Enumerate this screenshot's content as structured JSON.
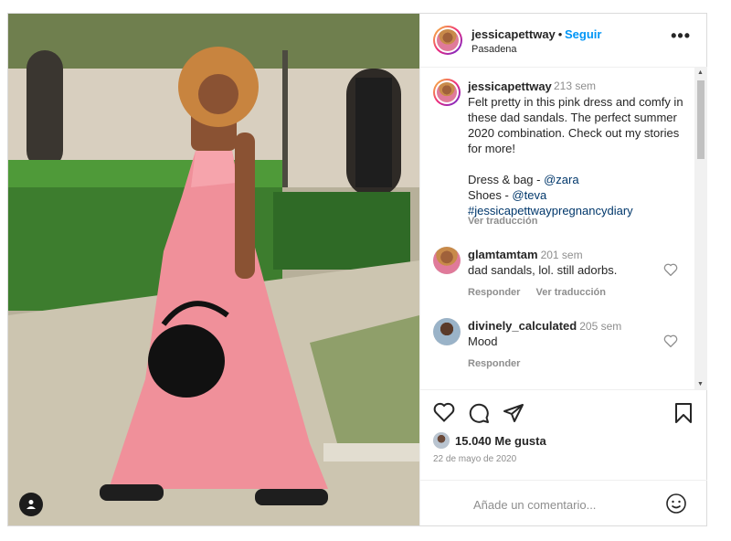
{
  "post": {
    "author": "jessicapettway",
    "separator": "•",
    "follow_label": "Seguir",
    "location": "Pasadena",
    "more_icon": "more-options-icon"
  },
  "caption": {
    "user": "jessicapettway",
    "time": "213 sem",
    "text_lines": [
      "Felt pretty in this pink dress and comfy in these dad sandals. The perfect summer 2020 combination. Check out my stories for more!",
      ""
    ],
    "main_text": "Felt pretty in this pink dress and comfy in these dad sandals. The perfect summer 2020 combination. Check out my stories for more!",
    "dress_line_prefix": "Dress & bag - ",
    "dress_mention": "@zara",
    "shoes_line_prefix": "Shoes - ",
    "shoes_mention": "@teva",
    "hashtag": "#jessicapettwaypregnancydiary",
    "translate_label": "Ver traducción"
  },
  "comments": [
    {
      "user": "glamtamtam",
      "time": "201 sem",
      "text": "dad sandals, lol. still adorbs.",
      "reply_label": "Responder",
      "translate_label": "Ver traducción"
    },
    {
      "user": "divinely_calculated",
      "time": "205 sem",
      "text": "Mood",
      "reply_label": "Responder"
    }
  ],
  "engagement": {
    "likes": "15.040 Me gusta",
    "date": "22 de mayo de 2020"
  },
  "add_comment": {
    "placeholder": "Añade un comentario..."
  },
  "colors": {
    "link_blue": "#0095f6",
    "mention_blue": "#00376b",
    "muted": "#8e8e8e",
    "dress_pink": "#f0909a"
  }
}
